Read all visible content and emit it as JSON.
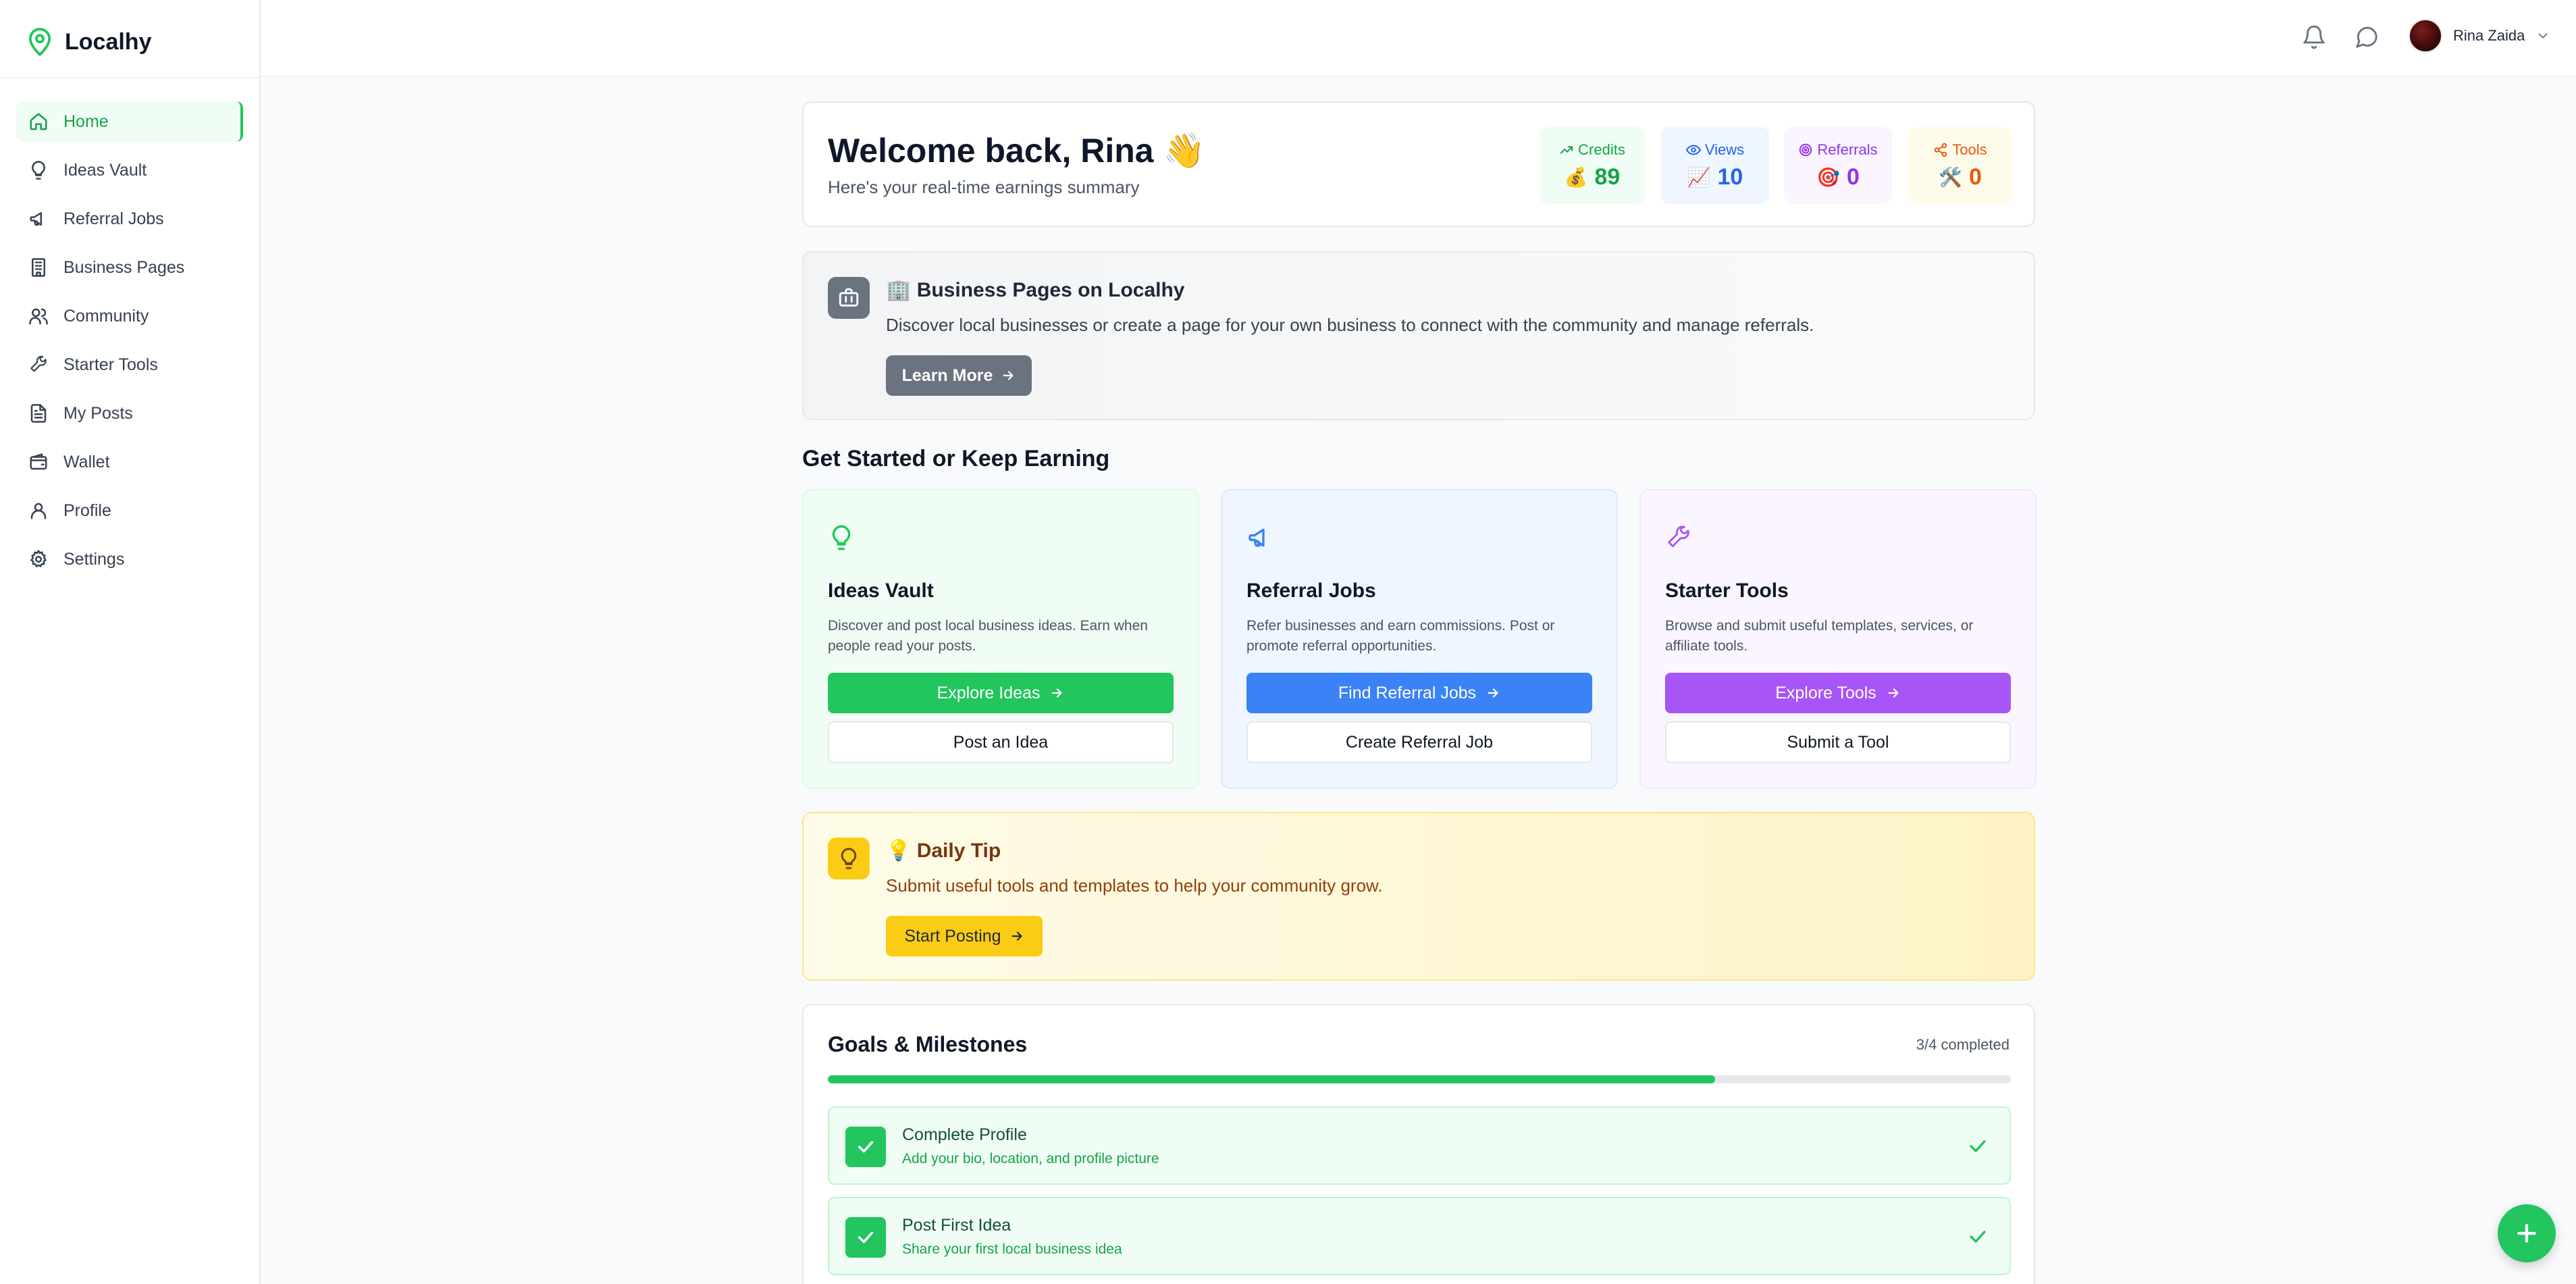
{
  "app": {
    "name": "Localhy"
  },
  "sidebar": {
    "items": [
      {
        "label": "Home",
        "icon": "home-icon",
        "active": true
      },
      {
        "label": "Ideas Vault",
        "icon": "lightbulb-icon"
      },
      {
        "label": "Referral Jobs",
        "icon": "megaphone-icon"
      },
      {
        "label": "Business Pages",
        "icon": "building-icon"
      },
      {
        "label": "Community",
        "icon": "users-icon"
      },
      {
        "label": "Starter Tools",
        "icon": "wrench-icon"
      },
      {
        "label": "My Posts",
        "icon": "document-icon"
      },
      {
        "label": "Wallet",
        "icon": "wallet-icon"
      },
      {
        "label": "Profile",
        "icon": "user-icon"
      },
      {
        "label": "Settings",
        "icon": "gear-icon"
      }
    ]
  },
  "topbar": {
    "user_name": "Rina Zaida"
  },
  "welcome": {
    "title": "Welcome back, Rina 👋",
    "subtitle": "Here's your real-time earnings summary",
    "stats": [
      {
        "label": "Credits",
        "emoji": "💰",
        "value": "89",
        "color": "#16a34a",
        "bg": "#f0fdf4"
      },
      {
        "label": "Views",
        "emoji": "📈",
        "value": "10",
        "color": "#2563eb",
        "bg": "#eff6ff"
      },
      {
        "label": "Referrals",
        "emoji": "🎯",
        "value": "0",
        "color": "#9333ea",
        "bg": "#faf5ff"
      },
      {
        "label": "Tools",
        "emoji": "🛠️",
        "value": "0",
        "color": "#ea580c",
        "bg": "#fffbeb"
      }
    ]
  },
  "business": {
    "title": "🏢 Business Pages on Localhy",
    "description": "Discover local businesses or create a page for your own business to connect with the community and manage referrals.",
    "button": "Learn More"
  },
  "section_title": "Get Started or Keep Earning",
  "features": [
    {
      "title": "Ideas Vault",
      "description": "Discover and post local business ideas. Earn when people read your posts.",
      "primary": "Explore Ideas",
      "secondary": "Post an Idea",
      "color": "#22c55e",
      "bg": "#f0fdf4",
      "icon": "lightbulb-icon"
    },
    {
      "title": "Referral Jobs",
      "description": "Refer businesses and earn commissions. Post or promote referral opportunities.",
      "primary": "Find Referral Jobs",
      "secondary": "Create Referral Job",
      "color": "#3b82f6",
      "bg": "#eff6ff",
      "icon": "megaphone-icon"
    },
    {
      "title": "Starter Tools",
      "description": "Browse and submit useful templates, services, or affiliate tools.",
      "primary": "Explore Tools",
      "secondary": "Submit a Tool",
      "color": "#a855f7",
      "bg": "#faf5ff",
      "icon": "wrench-icon"
    }
  ],
  "tip": {
    "title": "💡 Daily Tip",
    "text": "Submit useful tools and templates to help your community grow.",
    "button": "Start Posting"
  },
  "goals": {
    "title": "Goals & Milestones",
    "completed_text": "3/4 completed",
    "progress_fraction": 0.75,
    "items": [
      {
        "title": "Complete Profile",
        "description": "Add your bio, location, and profile picture"
      },
      {
        "title": "Post First Idea",
        "description": "Share your first local business idea"
      }
    ]
  }
}
